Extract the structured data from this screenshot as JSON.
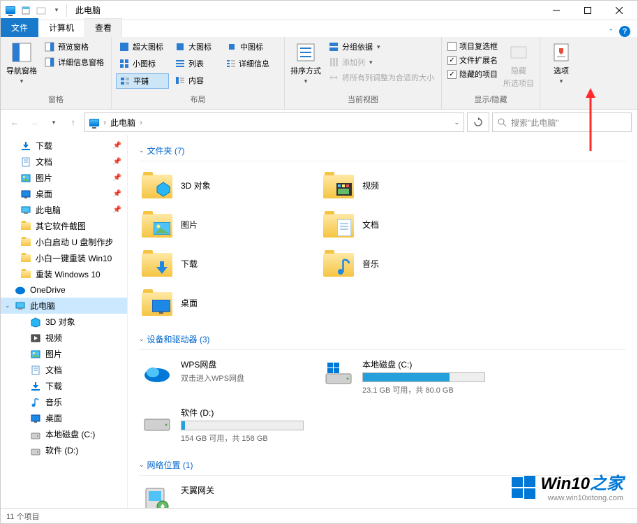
{
  "window": {
    "title": "此电脑"
  },
  "tabs": {
    "file": "文件",
    "computer": "计算机",
    "view": "查看"
  },
  "ribbon": {
    "panes": {
      "nav": "导航窗格",
      "preview": "预览窗格",
      "details": "详细信息窗格",
      "label": "窗格"
    },
    "layout": {
      "extra_large": "超大图标",
      "large": "大图标",
      "medium": "中图标",
      "small": "小图标",
      "list": "列表",
      "details": "详细信息",
      "tiles": "平铺",
      "content": "内容",
      "label": "布局"
    },
    "view": {
      "sort": "排序方式",
      "group": "分组依据",
      "add_col": "添加列",
      "fit_cols": "将所有列调整为合适的大小",
      "label": "当前视图"
    },
    "showhide": {
      "checkboxes": "项目复选框",
      "extensions": "文件扩展名",
      "hidden": "隐藏的项目",
      "hide": "隐藏",
      "hide_sub": "所选项目",
      "label": "显示/隐藏"
    },
    "options": "选项"
  },
  "address": {
    "location": "此电脑",
    "search_placeholder": "搜索\"此电脑\""
  },
  "sidebar": {
    "items": [
      {
        "label": "下载",
        "icon": "download",
        "pinned": true
      },
      {
        "label": "文档",
        "icon": "document",
        "pinned": true
      },
      {
        "label": "图片",
        "icon": "picture",
        "pinned": true
      },
      {
        "label": "桌面",
        "icon": "desktop",
        "pinned": true
      },
      {
        "label": "此电脑",
        "icon": "computer",
        "pinned": true
      },
      {
        "label": "其它软件截图",
        "icon": "folder"
      },
      {
        "label": "小白启动 U 盘制作步",
        "icon": "folder"
      },
      {
        "label": "小白一键重装 Win10",
        "icon": "folder"
      },
      {
        "label": "重装 Windows 10",
        "icon": "folder"
      },
      {
        "label": "OneDrive",
        "icon": "onedrive"
      },
      {
        "label": "此电脑",
        "icon": "computer",
        "selected": true,
        "expandable": true
      },
      {
        "label": "3D 对象",
        "icon": "3d",
        "indent": true
      },
      {
        "label": "视频",
        "icon": "video",
        "indent": true
      },
      {
        "label": "图片",
        "icon": "picture",
        "indent": true
      },
      {
        "label": "文档",
        "icon": "document",
        "indent": true
      },
      {
        "label": "下载",
        "icon": "download",
        "indent": true
      },
      {
        "label": "音乐",
        "icon": "music",
        "indent": true
      },
      {
        "label": "桌面",
        "icon": "desktop",
        "indent": true
      },
      {
        "label": "本地磁盘 (C:)",
        "icon": "drive",
        "indent": true
      },
      {
        "label": "软件 (D:)",
        "icon": "drive",
        "indent": true
      }
    ]
  },
  "content": {
    "folders_header": "文件夹 (7)",
    "folders": [
      {
        "name": "3D 对象",
        "icon": "3d"
      },
      {
        "name": "视频",
        "icon": "video"
      },
      {
        "name": "图片",
        "icon": "picture"
      },
      {
        "name": "文档",
        "icon": "document"
      },
      {
        "name": "下载",
        "icon": "download"
      },
      {
        "name": "音乐",
        "icon": "music"
      },
      {
        "name": "桌面",
        "icon": "desktop"
      }
    ],
    "drives_header": "设备和驱动器 (3)",
    "drives": [
      {
        "name": "WPS网盘",
        "sub": "双击进入WPS网盘",
        "icon": "wps",
        "bar": null
      },
      {
        "name": "本地磁盘 (C:)",
        "text": "23.1 GB 可用，共 80.0 GB",
        "icon": "drive-win",
        "fill": 71
      },
      {
        "name": "软件 (D:)",
        "text": "154 GB 可用，共 158 GB",
        "icon": "drive",
        "fill": 3
      }
    ],
    "network_header": "网络位置 (1)",
    "network": [
      {
        "name": "天翼网关",
        "icon": "network"
      }
    ]
  },
  "status": {
    "items": "11 个项目"
  },
  "watermark": {
    "brand": "Win10",
    "suffix": "之家",
    "url": "www.win10xitong.com"
  },
  "checkboxes": {
    "cb": false,
    "ext": true,
    "hidden": true
  }
}
